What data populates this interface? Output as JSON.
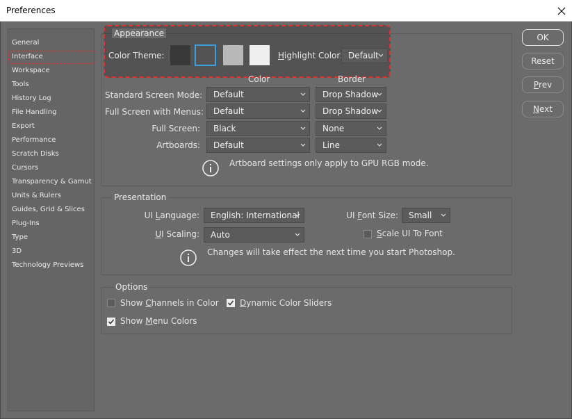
{
  "window": {
    "title": "Preferences"
  },
  "sidebar": {
    "items": [
      "General",
      "Interface",
      "Workspace",
      "Tools",
      "History Log",
      "File Handling",
      "Export",
      "Performance",
      "Scratch Disks",
      "Cursors",
      "Transparency & Gamut",
      "Units & Rulers",
      "Guides, Grid & Slices",
      "Plug-Ins",
      "Type",
      "3D",
      "Technology Previews"
    ],
    "selected": "Interface"
  },
  "appearance": {
    "title": "Appearance",
    "color_theme_label": "Color Theme:",
    "highlight_label": "Highlight Color:",
    "highlight_value": "Default",
    "swatches": [
      "#383838",
      "#535353",
      "#b8b8b8",
      "#f0f0f0"
    ],
    "col_color": "Color",
    "col_border": "Border",
    "rows": [
      {
        "label": "Standard Screen Mode:",
        "color": "Default",
        "border": "Drop Shadow"
      },
      {
        "label": "Full Screen with Menus:",
        "color": "Default",
        "border": "Drop Shadow"
      },
      {
        "label": "Full Screen:",
        "color": "Black",
        "border": "None"
      },
      {
        "label": "Artboards:",
        "color": "Default",
        "border": "Line"
      }
    ],
    "note": "Artboard settings only apply to GPU RGB mode."
  },
  "presentation": {
    "title": "Presentation",
    "ui_language_label": "UI Language:",
    "ui_language_value": "English: International",
    "ui_font_size_label": "UI Font Size:",
    "ui_font_size_value": "Small",
    "ui_scaling_label": "UI Scaling:",
    "ui_scaling_value": "Auto",
    "scale_font_label": "Scale UI To Font",
    "note": "Changes will take effect the next time you start Photoshop."
  },
  "options": {
    "title": "Options",
    "show_channels": "Show Channels in Color",
    "dynamic_sliders": "Dynamic Color Sliders",
    "show_menu_colors": "Show Menu Colors"
  },
  "buttons": {
    "ok": "OK",
    "reset": "Reset",
    "prev": "Prev",
    "next": "Next"
  }
}
